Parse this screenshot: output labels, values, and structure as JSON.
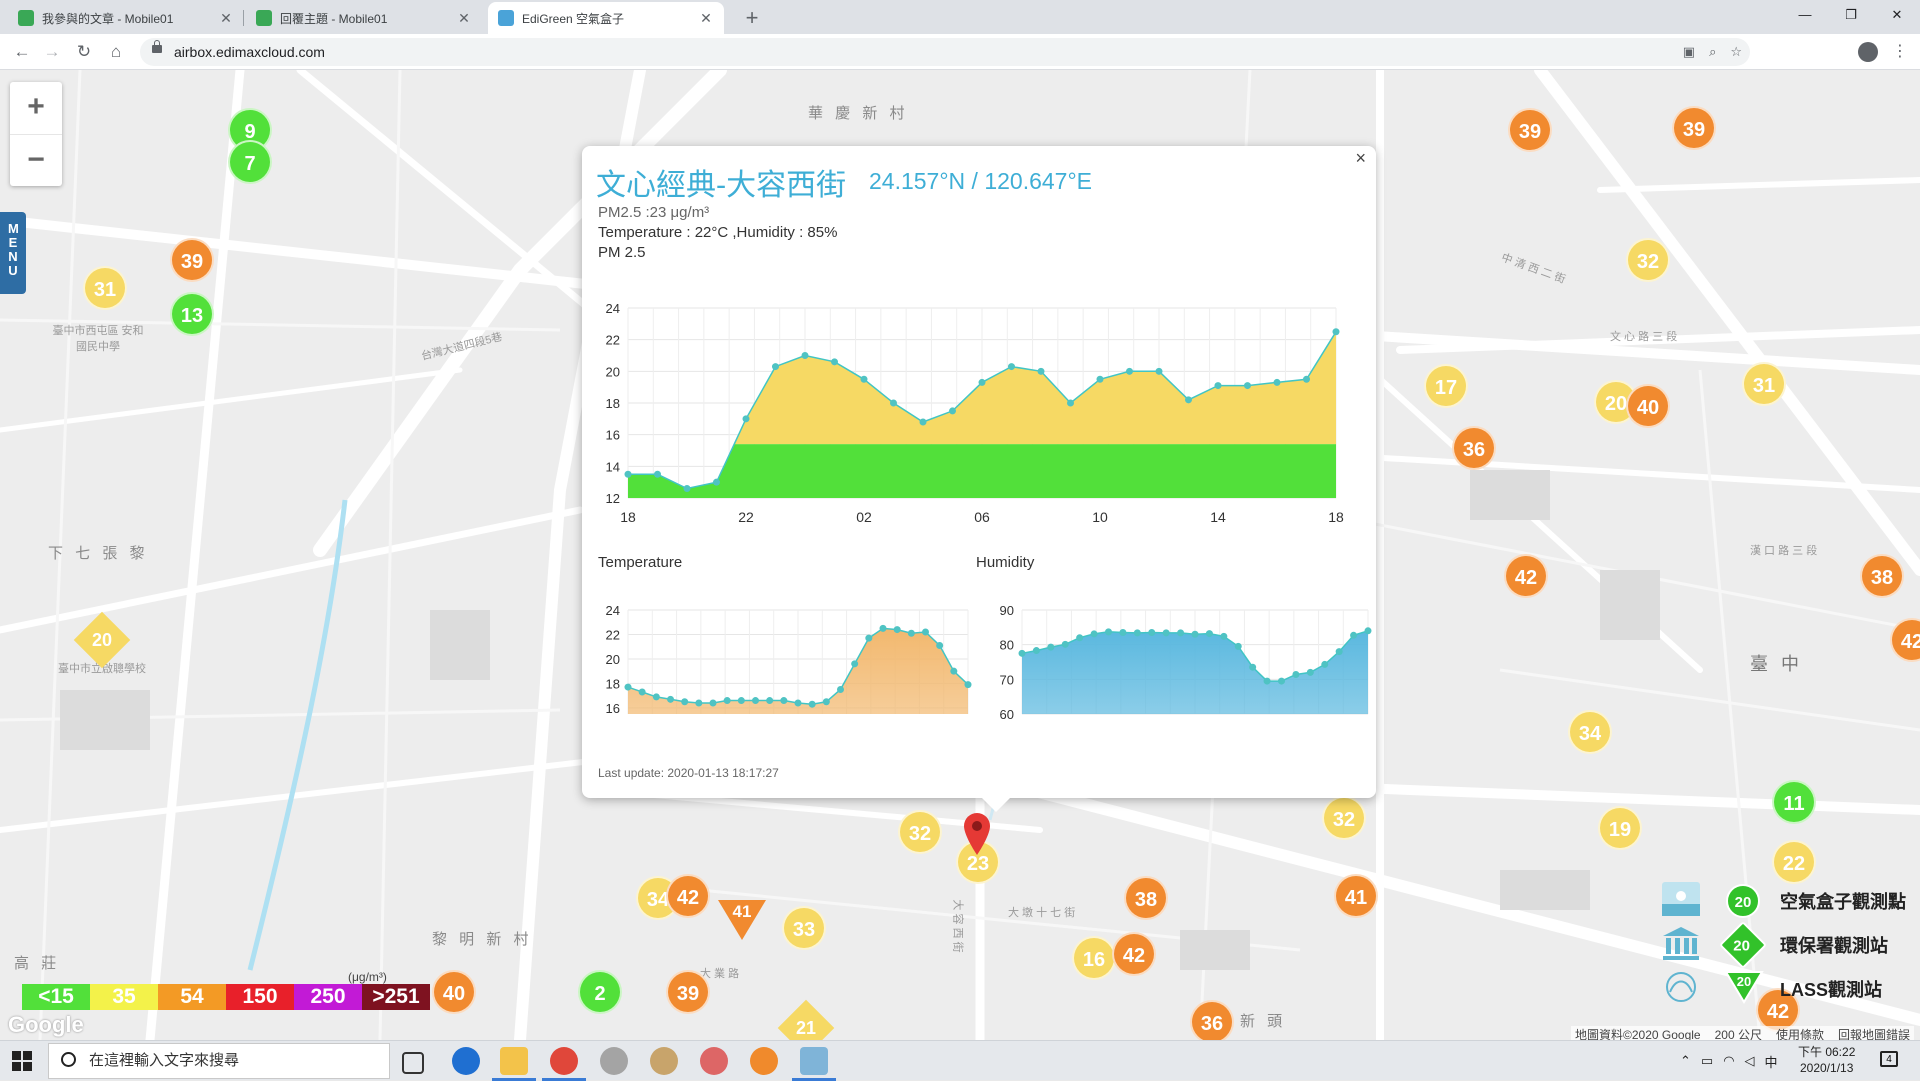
{
  "browser": {
    "tabs": [
      {
        "title": "我參與的文章 - Mobile01",
        "close": "✕"
      },
      {
        "title": "回覆主題 - Mobile01",
        "close": "✕"
      },
      {
        "title": "EdiGreen 空氣盒子",
        "close": "✕"
      }
    ],
    "new_tab": "+",
    "url": "airbox.edimaxcloud.com",
    "window_buttons": [
      "—",
      "❐",
      "✕"
    ]
  },
  "map": {
    "zoom_in": "+",
    "zoom_out": "−",
    "menu_label": "MENU",
    "place_labels": [
      "華 慶 新 村",
      "下 七 張 黎",
      "黎 明 新 村",
      "高 莊",
      "台灣大道四段5巷",
      "臺中市西屯區 安和國民中學",
      "臺中市立啟聰學校",
      "大 業 路",
      "大 容 西 街",
      "大 墩 十 七 街",
      "中 清 西 二 街",
      "文 心 路 三 段",
      "漢 口 路 三 段",
      "臺 中",
      "新 頭"
    ],
    "markers": [
      {
        "value": "9",
        "level": "green"
      },
      {
        "value": "7",
        "level": "green"
      },
      {
        "value": "39",
        "level": "orange"
      },
      {
        "value": "31",
        "level": "yellow"
      },
      {
        "value": "13",
        "level": "green"
      },
      {
        "value": "20",
        "level": "yellow",
        "shape": "diamond"
      },
      {
        "value": "39",
        "level": "orange"
      },
      {
        "value": "39",
        "level": "orange"
      },
      {
        "value": "32",
        "level": "yellow"
      },
      {
        "value": "17",
        "level": "yellow"
      },
      {
        "value": "20",
        "level": "yellow"
      },
      {
        "value": "40",
        "level": "orange"
      },
      {
        "value": "36",
        "level": "orange"
      },
      {
        "value": "31",
        "level": "yellow"
      },
      {
        "value": "42",
        "level": "orange"
      },
      {
        "value": "38",
        "level": "orange"
      },
      {
        "value": "42",
        "level": "orange"
      },
      {
        "value": "34",
        "level": "yellow"
      },
      {
        "value": "11",
        "level": "green"
      },
      {
        "value": "19",
        "level": "yellow"
      },
      {
        "value": "32",
        "level": "yellow"
      },
      {
        "value": "22",
        "level": "yellow"
      },
      {
        "value": "32",
        "level": "yellow"
      },
      {
        "value": "23",
        "level": "yellow"
      },
      {
        "value": "38",
        "level": "orange"
      },
      {
        "value": "41",
        "level": "orange"
      },
      {
        "value": "34",
        "level": "yellow"
      },
      {
        "value": "42",
        "level": "orange"
      },
      {
        "value": "41",
        "level": "orange",
        "shape": "triangle"
      },
      {
        "value": "33",
        "level": "yellow"
      },
      {
        "value": "16",
        "level": "yellow"
      },
      {
        "value": "42",
        "level": "orange"
      },
      {
        "value": "40",
        "level": "orange"
      },
      {
        "value": "2",
        "level": "green"
      },
      {
        "value": "39",
        "level": "orange"
      },
      {
        "value": "21",
        "level": "yellow",
        "shape": "diamond"
      },
      {
        "value": "36",
        "level": "orange"
      },
      {
        "value": "42",
        "level": "orange"
      }
    ],
    "colors": {
      "green": "#52e03a",
      "yellow": "#f6d964",
      "orange": "#f18a2f",
      "red": "#e8202a",
      "purple": "#c21ad6",
      "maroon": "#7e1220"
    }
  },
  "popup": {
    "close": "×",
    "title": "文心經典-大容西街",
    "coordinates": "24.157°N / 120.647°E",
    "pm25_line": "PM2.5 :23 μg/m³",
    "temp_hum_line": "Temperature : 22°C ,Humidity : 85%",
    "pm25_label": "PM 2.5",
    "temperature_label": "Temperature",
    "humidity_label": "Humidity",
    "last_update": "Last update: 2020-01-13 18:17:27"
  },
  "chart_data": [
    {
      "type": "area",
      "title": "PM 2.5",
      "x_tick_labels": [
        "18",
        "22",
        "02",
        "06",
        "10",
        "14",
        "18"
      ],
      "ylim": [
        12,
        24
      ],
      "y_ticks": [
        12,
        14,
        16,
        18,
        20,
        22,
        24
      ],
      "grid": true,
      "threshold_band": {
        "below": 15.4,
        "color": "#52e03a",
        "above_color": "#f6d964"
      },
      "values": [
        13.5,
        13.5,
        12.6,
        13.0,
        17.0,
        20.3,
        21.0,
        20.6,
        19.5,
        18.0,
        16.8,
        17.5,
        19.3,
        20.3,
        20.0,
        18.0,
        19.5,
        20.0,
        20.0,
        18.2,
        19.1,
        19.1,
        19.3,
        19.5,
        22.5
      ]
    },
    {
      "type": "area",
      "title": "Temperature",
      "ylim": [
        15.5,
        24
      ],
      "y_ticks": [
        16,
        18,
        20,
        22,
        24
      ],
      "grid": true,
      "color": "#f2b86e",
      "values": [
        17.7,
        17.3,
        16.9,
        16.7,
        16.5,
        16.4,
        16.4,
        16.6,
        16.6,
        16.6,
        16.6,
        16.6,
        16.4,
        16.3,
        16.5,
        17.5,
        19.6,
        21.7,
        22.5,
        22.4,
        22.1,
        22.2,
        21.1,
        19.0,
        17.9
      ]
    },
    {
      "type": "area",
      "title": "Humidity",
      "ylim": [
        60,
        90
      ],
      "y_ticks": [
        60,
        70,
        80,
        90
      ],
      "grid": true,
      "color": "#5ab8df",
      "values": [
        77.5,
        78.3,
        79.3,
        80.1,
        82.0,
        83.1,
        83.7,
        83.5,
        83.4,
        83.5,
        83.4,
        83.4,
        83.0,
        83.2,
        82.4,
        79.5,
        73.5,
        69.5,
        69.5,
        71.4,
        72.0,
        74.3,
        78.0,
        82.7,
        84.0
      ]
    }
  ],
  "legend": {
    "scale": [
      {
        "label": "<15",
        "color": "#52e03a"
      },
      {
        "label": "35",
        "color": "#f3f24a"
      },
      {
        "label": "54",
        "color": "#f39a25"
      },
      {
        "label": "150",
        "color": "#e8202a"
      },
      {
        "label": "250",
        "color": "#c21ad6"
      },
      {
        "label": ">251",
        "color": "#7e1220"
      }
    ],
    "unit": "(μg/m³)",
    "stations": [
      {
        "label": "空氣盒子觀測點",
        "badge": "20"
      },
      {
        "label": "環保署觀測站",
        "badge": "20"
      },
      {
        "label": "LASS觀測站",
        "badge": "20"
      }
    ],
    "google": "Google",
    "attribution": [
      "地圖資料©2020 Google",
      "200 公尺",
      "使用條款",
      "回報地圖錯誤"
    ]
  },
  "taskbar": {
    "search_placeholder": "在這裡輸入文字來搜尋",
    "time": "下午 06:22",
    "date": "2020/1/13",
    "ime": "中",
    "notifications": "4"
  }
}
